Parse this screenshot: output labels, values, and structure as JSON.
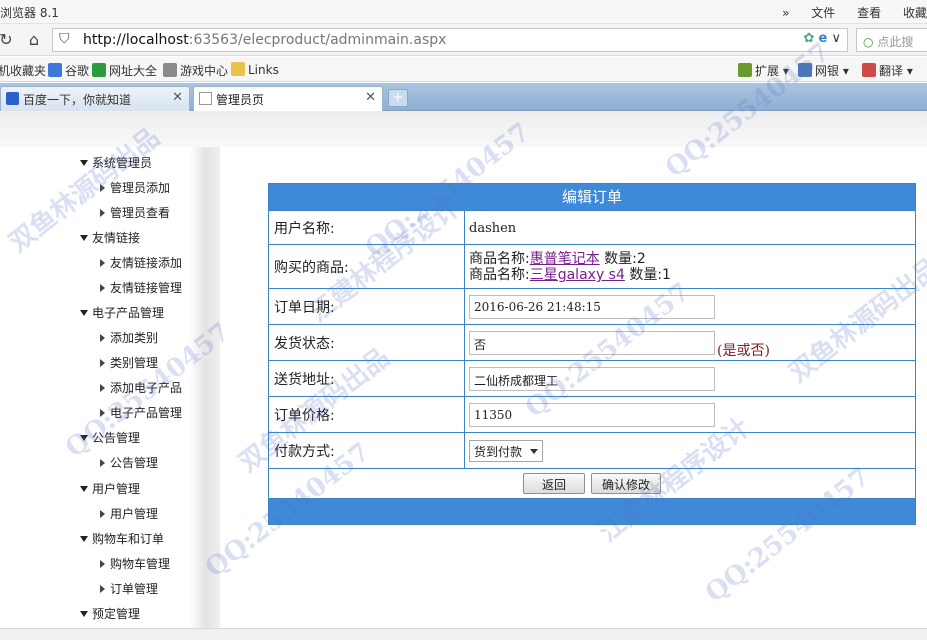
{
  "browser": {
    "title": "浏览器 8.1",
    "menu": [
      "»",
      "文件",
      "查看",
      "收藏"
    ],
    "url": {
      "host": "http://localhost",
      "rest": ":63563/elecproduct/adminmain.aspx"
    },
    "search_placeholder": "点此搜",
    "bookmarks": [
      {
        "label": "机收藏夹",
        "icon_color": "#e0a020"
      },
      {
        "label": "谷歌",
        "icon_color": "#3b78d8"
      },
      {
        "label": "网址大全",
        "icon_color": "#2e9c3e"
      },
      {
        "label": "游戏中心",
        "icon_color": "#777777"
      },
      {
        "label": "Links",
        "icon_color": "#e8c24a"
      }
    ],
    "bookmarks_right": [
      {
        "label": "扩展"
      },
      {
        "label": "网银"
      },
      {
        "label": "翻译"
      }
    ],
    "tabs": [
      {
        "label": "百度一下，你就知道",
        "active": false
      },
      {
        "label": "管理员页",
        "active": true
      }
    ],
    "new_tab": "+"
  },
  "sidebar": {
    "groups": [
      {
        "label": "系统管理员",
        "items": [
          "管理员添加",
          "管理员查看"
        ]
      },
      {
        "label": "友情链接",
        "items": [
          "友情链接添加",
          "友情链接管理"
        ]
      },
      {
        "label": "电子产品管理",
        "items": [
          "添加类别",
          "类别管理",
          "添加电子产品",
          "电子产品管理"
        ]
      },
      {
        "label": "公告管理",
        "items": [
          "公告管理"
        ]
      },
      {
        "label": "用户管理",
        "items": [
          "用户管理"
        ]
      },
      {
        "label": "购物车和订单",
        "items": [
          "购物车管理",
          "订单管理"
        ]
      },
      {
        "label": "预定管理",
        "items": []
      }
    ]
  },
  "form": {
    "title": "编辑订单",
    "username_label": "用户名称:",
    "username_value": "dashen",
    "goods_label": "购买的商品:",
    "goods": [
      {
        "prefix": "商品名称:",
        "name": "惠普笔记本",
        "qty_label": "数量:",
        "qty": "2"
      },
      {
        "prefix": "商品名称:",
        "name": "三星galaxy s4",
        "qty_label": "数量:",
        "qty": "1"
      }
    ],
    "date_label": "订单日期:",
    "date_value": "2016-06-26 21:48:15",
    "status_label": "发货状态:",
    "status_value": "否",
    "status_hint": "(是或否)",
    "address_label": "送货地址:",
    "address_value": "二仙桥成都理工",
    "price_label": "订单价格:",
    "price_value": "11350",
    "payment_label": "付款方式:",
    "payment_value": "货到付款",
    "back_button": "返回",
    "confirm_button": "确认修改"
  },
  "watermark": {
    "qq": "QQ:25540457",
    "text1": "江建林程序设计",
    "text2": "双鱼林源码出品"
  }
}
